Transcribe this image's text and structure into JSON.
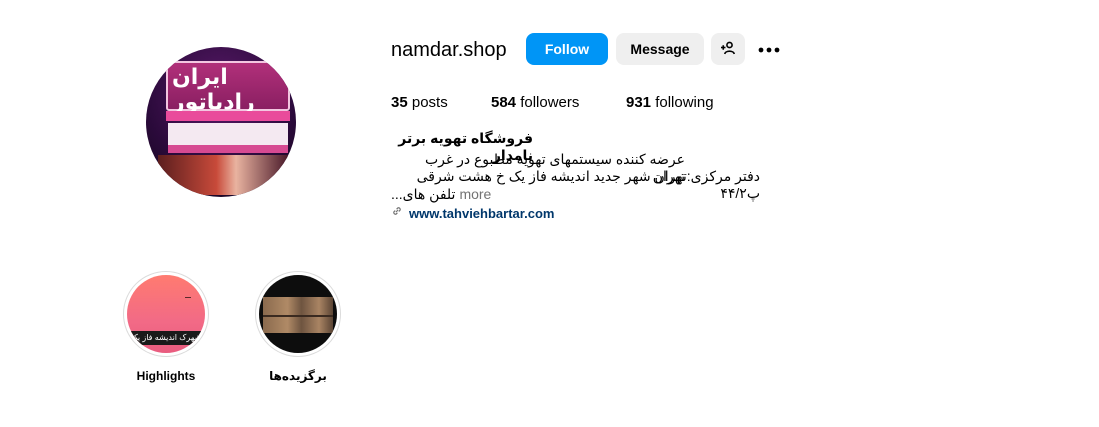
{
  "profile": {
    "username": "namdar.shop",
    "avatar_sign_text": "ایران رادیاتور"
  },
  "actions": {
    "follow_label": "Follow",
    "message_label": "Message",
    "add_user_icon": "person-add-icon",
    "more_icon": "more-horizontal-icon"
  },
  "stats": {
    "posts_count": "35",
    "posts_label": "posts",
    "followers_count": "584",
    "followers_label": "followers",
    "following_count": "931",
    "following_label": "following"
  },
  "bio": {
    "name": "فروشگاه تهویه برتر نامدار",
    "line1": "عرضه کننده سیستمهای تهویه مطبوع در غرب تهران",
    "line2": "دفتر مرکزی:تهران شهر جدید اندیشه فاز یک خ هشت شرقی پ۴۴/۲",
    "line3": "تلفن های...",
    "more_label": "more",
    "link_icon": "link-icon",
    "link": "www.tahviehbartar.com"
  },
  "highlights": [
    {
      "label": "Highlights",
      "caption": "شهرک اندیشه فاز یک"
    },
    {
      "label": "برگزیده‌ها"
    }
  ],
  "colors": {
    "accent": "#0095f6",
    "secondary_button": "#efefef",
    "link": "#00376b",
    "muted": "#737373"
  }
}
